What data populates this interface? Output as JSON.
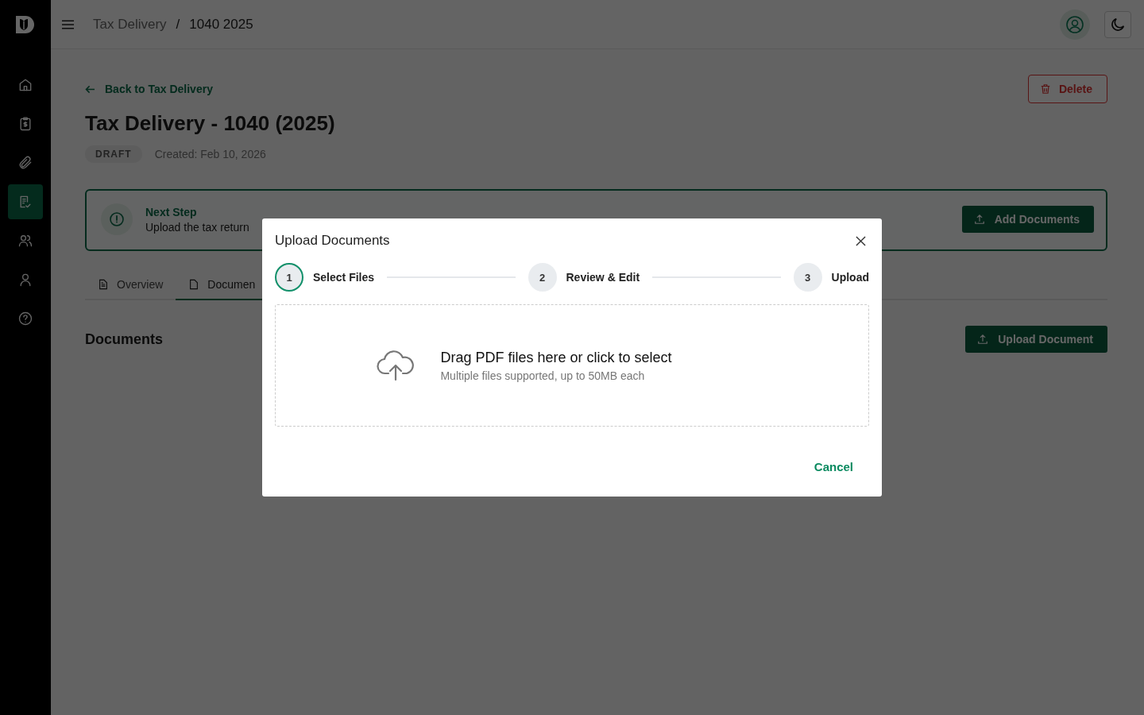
{
  "sidebar": {
    "items": [
      {
        "selected": false
      },
      {
        "selected": false
      },
      {
        "selected": false
      },
      {
        "selected": true
      },
      {
        "selected": false
      },
      {
        "selected": false
      },
      {
        "selected": false
      }
    ]
  },
  "header": {
    "breadcrumb": [
      "Tax Delivery",
      "/",
      "1040 2025"
    ]
  },
  "page": {
    "back_link": "Back to Tax Delivery",
    "delete_button": "Delete",
    "title": "Tax Delivery - 1040 (2025)",
    "status_badge": "DRAFT",
    "created": "Created: Feb 10, 2026",
    "next_step": {
      "title": "Next Step",
      "text": "Upload the tax return",
      "button": "Add Documents"
    },
    "tabs": [
      {
        "label": "Overview",
        "selected": false
      },
      {
        "label": "Documen",
        "selected": true
      }
    ],
    "section_title": "Documents",
    "upload_button": "Upload Document"
  },
  "dialog": {
    "title": "Upload Documents",
    "steps": [
      {
        "number": "1",
        "label": "Select Files",
        "selected": true
      },
      {
        "number": "2",
        "label": "Review & Edit",
        "selected": false
      },
      {
        "number": "3",
        "label": "Upload",
        "selected": false
      }
    ],
    "dropzone": {
      "title": "Drag PDF files here or click to select",
      "hint": "Multiple files supported, up to 50MB each"
    },
    "cancel_button": "Cancel"
  }
}
